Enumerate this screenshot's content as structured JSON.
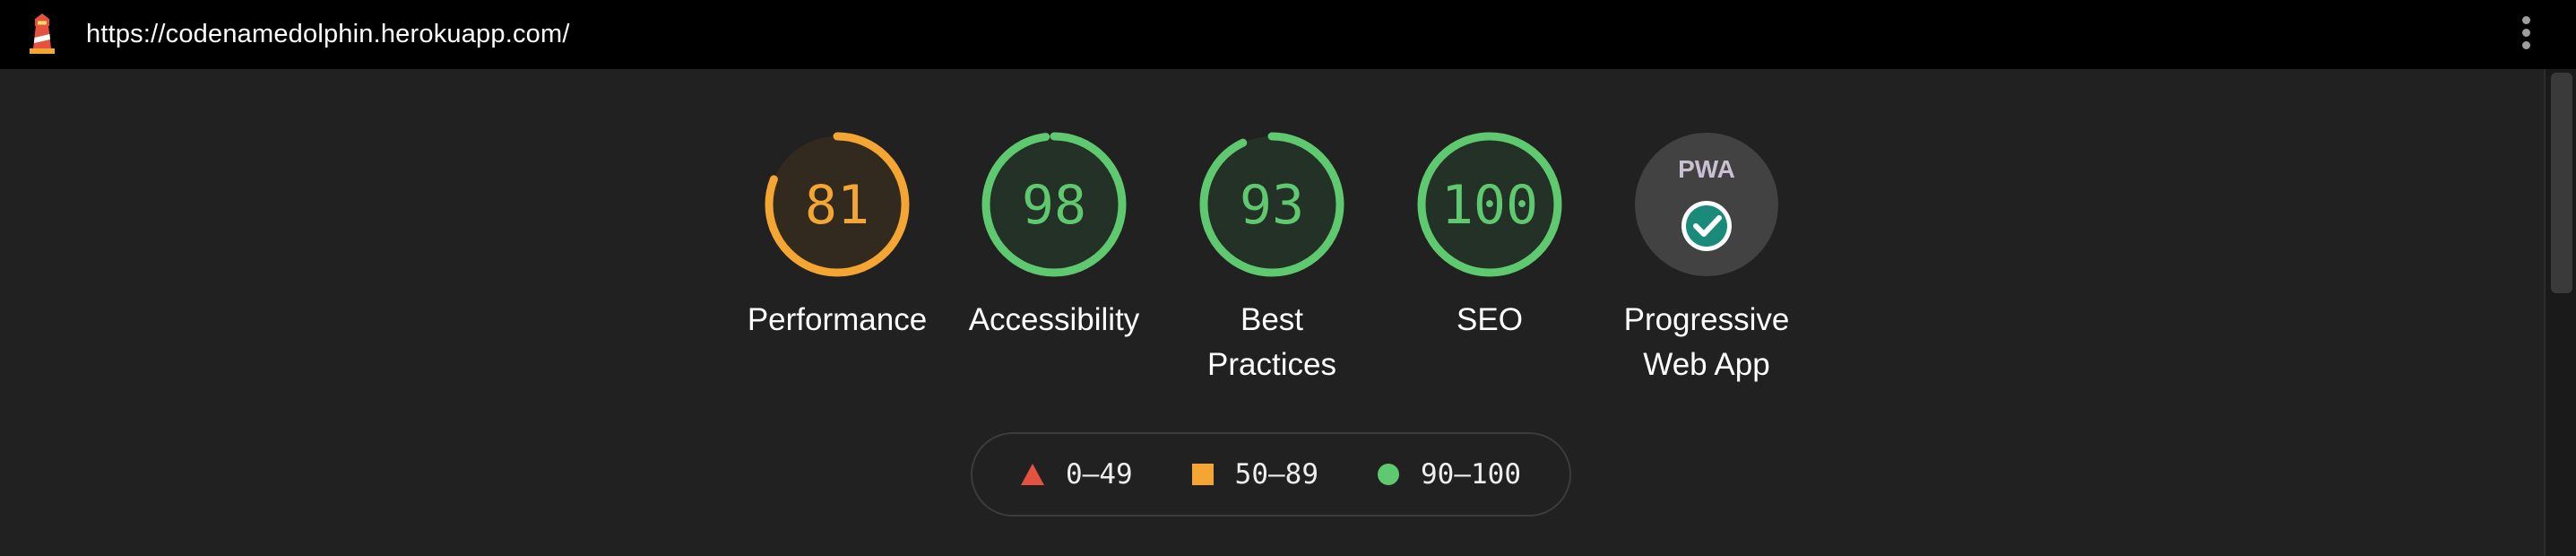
{
  "browser": {
    "url": "https://codenamedolphin.herokuapp.com/"
  },
  "colors": {
    "pass": "#5ec96e",
    "average": "#f4a532",
    "fail": "#e5523f",
    "background": "#212121"
  },
  "gauges": [
    {
      "score": "81",
      "label": "Performance",
      "status": "average"
    },
    {
      "score": "98",
      "label": "Accessibility",
      "status": "pass"
    },
    {
      "score": "93",
      "label": "Best Practices",
      "status": "pass"
    },
    {
      "score": "100",
      "label": "SEO",
      "status": "pass"
    },
    {
      "score": "",
      "label": "Progressive Web App",
      "status": "pwa",
      "badge_text": "PWA",
      "icon": "check-circle-icon"
    }
  ],
  "legend": [
    {
      "range": "0–49",
      "icon": "triangle-icon"
    },
    {
      "range": "50–89",
      "icon": "square-icon"
    },
    {
      "range": "90–100",
      "icon": "circle-icon"
    }
  ]
}
